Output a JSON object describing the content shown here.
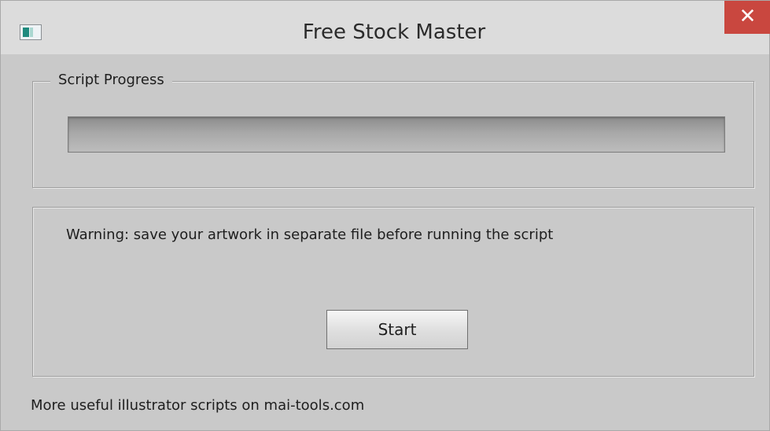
{
  "window": {
    "title": "Free Stock Master",
    "app_icon": "app-window-icon",
    "close_icon": "close-icon",
    "close_glyph": "✕"
  },
  "progress_group": {
    "legend": "Script Progress",
    "progress_fraction": 0
  },
  "warning_group": {
    "warning_text": "Warning: save your artwork in separate file before running the script",
    "start_label": "Start"
  },
  "footer": {
    "text": "More useful illustrator scripts on mai-tools.com"
  },
  "colors": {
    "close_button": "#c9473f",
    "progress_fill": "#3fae49"
  }
}
